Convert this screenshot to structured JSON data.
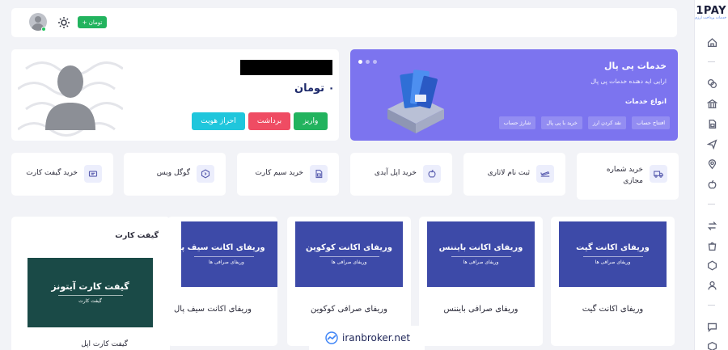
{
  "brand": {
    "logo": "1PAY",
    "tagline": "خدمات پرداخت ارزی"
  },
  "topbar": {
    "balance_pill": "+ تومان"
  },
  "profile": {
    "amount": "۰ تومان",
    "buttons": {
      "deposit": "واریز",
      "withdraw": "برداشت",
      "verify": "احراز هویت"
    }
  },
  "banner": {
    "title": "خدمات پی پال",
    "description": "ارایی ایه دهنده خدمات پی پال",
    "types_heading": "انواع خدمات",
    "chips": [
      "افتتاح حساب",
      "نقد کردن ارز",
      "خرید با پی پال",
      "شارژ حساب"
    ]
  },
  "services": [
    {
      "label": "خرید شماره مجازی",
      "icon": "truck-icon"
    },
    {
      "label": "ثبت نام لاتاری",
      "icon": "plane-icon"
    },
    {
      "label": "خرید اپل آیدی",
      "icon": "apple-icon"
    },
    {
      "label": "خرید سیم کارت",
      "icon": "sim-card-icon"
    },
    {
      "label": "گوگل ویس",
      "icon": "google-voice-icon"
    },
    {
      "label": "خرید گیفت کارت",
      "icon": "gift-card-icon"
    }
  ],
  "gift": {
    "title": "گیفت کارت",
    "image_title": "گیفت کارت آیتونز",
    "image_subtitle": "گیفت کارت",
    "caption": "گیفت کارت اپل"
  },
  "verify_cards": [
    {
      "image_title": "وریفای اکانت گیت",
      "image_subtitle": "وریفای صرافی ها",
      "title": "وریفای اکانت گیت"
    },
    {
      "image_title": "وریفای اکانت بایننس",
      "image_subtitle": "وریفای صرافی ها",
      "title": "وریفای صرافی بایننس"
    },
    {
      "image_title": "وریفای اکانت کوکوین",
      "image_subtitle": "وریفای صرافی ها",
      "title": "وریفای صرافی کوکوین"
    },
    {
      "image_title": "وریفای اکانت سیف پال",
      "image_subtitle": "وریفای صرافی ها",
      "title": "وریفای اکانت سیف پال"
    }
  ],
  "watermark": {
    "text": "iranbroker.net"
  },
  "colors": {
    "banner": "#7c74ef",
    "deposit": "#22b35e",
    "withdraw": "#ef4c63",
    "verify": "#1fc6dc",
    "card": "#3d4aa8",
    "gift": "#1a4a47"
  }
}
